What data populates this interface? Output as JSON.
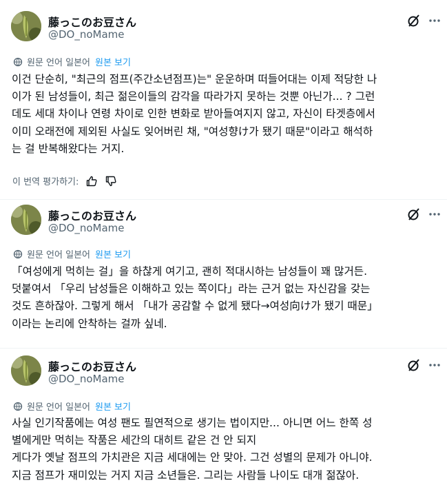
{
  "posts": [
    {
      "author_name": "藤っこのお豆さん",
      "author_handle": "@DO_noMame",
      "translation_note": "원문 언어 일본어",
      "show_original_label": "원본 보기",
      "body_lines": [
        "이건 단순히, \"최근의 점프(주간소년점프)는\" 운운하며 떠들어대는 이제 적당한 나",
        "이가 된 남성들이, 최근 젊은이들의 감각을 따라가지 못하는 것뿐 아닌가... ?  그런",
        "데도 세대 차이나 연령 차이로 인한 변화로 받아들여지지 않고, 자신이 타겟층에서",
        "이미 오래전에 제외된 사실도 잊어버린 채, \"여성향け가 됐기 때문\"이라고 해석하",
        "는 걸 반복해왔다는 거지."
      ],
      "rate_label": "이 번역 평가하기:"
    },
    {
      "author_name": "藤っこのお豆さん",
      "author_handle": "@DO_noMame",
      "translation_note": "원문 언어 일본어",
      "show_original_label": "원본 보기",
      "body_lines": [
        "「여성에게 먹히는 걸」을 하찮게 여기고, 괜히 적대시하는 남성들이 꽤 많거든.",
        "덧붙여서 「우리 남성들은 이해하고 있는 쪽이다」라는 근거 없는 자신감을 갖는",
        "것도 흔하잖아. 그렇게 해서 「내가 공감할 수 없게 됐다→여성向け가 됐기 때문」",
        "이라는 논리에 안착하는 걸까 싶네."
      ]
    },
    {
      "author_name": "藤っこのお豆さん",
      "author_handle": "@DO_noMame",
      "translation_note": "원문 언어 일본어",
      "show_original_label": "원본 보기",
      "body_lines": [
        "사실 인기작품에는 여성 팬도 필연적으로 생기는 법이지만... 아니면 어느 한쪽 성",
        "별에게만 먹히는 작품은 세간의 대히트 같은 건 안 되지",
        "게다가 옛날 점프의 가치관은 지금 세대에는 안 맞아. 그건 성별의 문제가 아니야.",
        "지금 점프가 재미있는 거지 지금 소년들은. 그리는 사람들 나이도 대개 젊잖아."
      ]
    }
  ],
  "icons": {
    "grok": "grok-slash-circle-icon",
    "more": "more-dots-icon",
    "translate": "globe-icon",
    "thumbs_up": "thumbs-up-icon",
    "thumbs_down": "thumbs-down-icon"
  },
  "colors": {
    "text": "#0f1419",
    "secondary": "#536471",
    "link": "#1d9bf0",
    "divider": "#eff3f4"
  }
}
